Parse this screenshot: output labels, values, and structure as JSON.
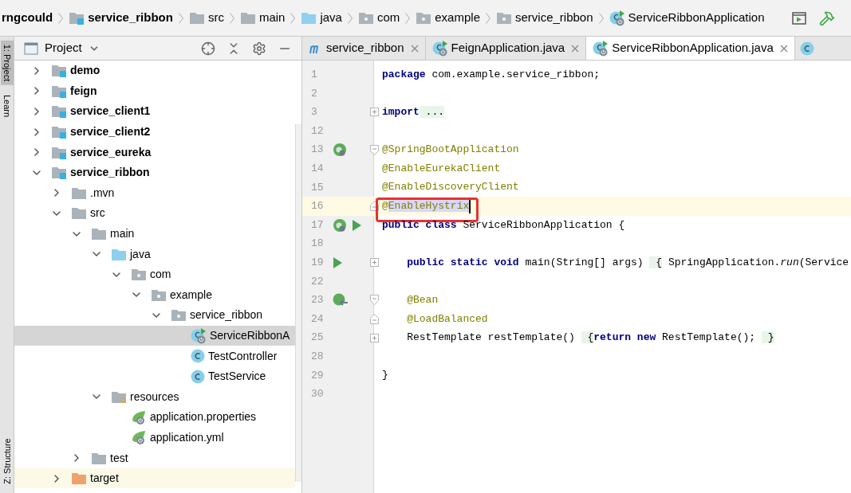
{
  "breadcrumbs": [
    {
      "label": "rngcould",
      "kind": "none",
      "bold": true
    },
    {
      "label": "service_ribbon",
      "kind": "module",
      "bold": true
    },
    {
      "label": "src",
      "kind": "folder",
      "bold": false
    },
    {
      "label": "main",
      "kind": "folder",
      "bold": false
    },
    {
      "label": "java",
      "kind": "source-folder",
      "bold": false
    },
    {
      "label": "com",
      "kind": "package",
      "bold": false
    },
    {
      "label": "example",
      "kind": "package",
      "bold": false
    },
    {
      "label": "service_ribbon",
      "kind": "package",
      "bold": false
    },
    {
      "label": "ServiceRibbonApplication",
      "kind": "spring-class",
      "bold": false
    }
  ],
  "side_tabs": [
    {
      "label": "1: Project",
      "selected": true
    },
    {
      "label": "Learn",
      "selected": false
    },
    {
      "label": "Z: Structure",
      "selected": false
    }
  ],
  "project_panel": {
    "title": "Project",
    "tree": [
      {
        "label": "demo",
        "kind": "module",
        "bold": true,
        "expanded": false
      },
      {
        "label": "feign",
        "kind": "module",
        "bold": true,
        "expanded": false
      },
      {
        "label": "service_client1",
        "kind": "module",
        "bold": true,
        "expanded": false
      },
      {
        "label": "service_client2",
        "kind": "module",
        "bold": true,
        "expanded": false
      },
      {
        "label": "service_eureka",
        "kind": "module",
        "bold": true,
        "expanded": false
      },
      {
        "label": "service_ribbon",
        "kind": "module",
        "bold": true,
        "expanded": true,
        "children": [
          {
            "label": ".mvn",
            "kind": "folder",
            "bold": false,
            "expanded": false
          },
          {
            "label": "src",
            "kind": "folder",
            "bold": false,
            "expanded": true,
            "children": [
              {
                "label": "main",
                "kind": "folder",
                "bold": false,
                "expanded": true,
                "children": [
                  {
                    "label": "java",
                    "kind": "source-folder",
                    "bold": false,
                    "expanded": true,
                    "children": [
                      {
                        "label": "com",
                        "kind": "package",
                        "bold": false,
                        "expanded": true,
                        "children": [
                          {
                            "label": "example",
                            "kind": "package",
                            "bold": false,
                            "expanded": true,
                            "children": [
                              {
                                "label": "service_ribbon",
                                "kind": "package",
                                "bold": false,
                                "expanded": true,
                                "children": [
                                  {
                                    "label": "ServiceRibbonA",
                                    "kind": "spring-class",
                                    "bold": false,
                                    "selected": true
                                  },
                                  {
                                    "label": "TestController",
                                    "kind": "class",
                                    "bold": false,
                                    "selected": false
                                  },
                                  {
                                    "label": "TestService",
                                    "kind": "class",
                                    "bold": false,
                                    "selected": false
                                  }
                                ]
                              }
                            ]
                          }
                        ]
                      }
                    ]
                  },
                  {
                    "label": "resources",
                    "kind": "resources-folder",
                    "bold": false,
                    "expanded": true,
                    "children": [
                      {
                        "label": "application.properties",
                        "kind": "spring-config",
                        "bold": false,
                        "selected": false
                      },
                      {
                        "label": "application.yml",
                        "kind": "spring-config",
                        "bold": false,
                        "selected": false
                      }
                    ]
                  }
                ]
              },
              {
                "label": "test",
                "kind": "folder",
                "bold": false,
                "expanded": false
              }
            ]
          },
          {
            "label": "target",
            "kind": "excluded-folder",
            "bold": false,
            "expanded": false
          }
        ]
      }
    ]
  },
  "editor": {
    "tabs": [
      {
        "label": "service_ribbon",
        "kind": "maven",
        "selected": false
      },
      {
        "label": "FeignApplication.java",
        "kind": "spring-class",
        "selected": false
      },
      {
        "label": "ServiceRibbonApplication.java",
        "kind": "spring-class",
        "selected": true
      }
    ],
    "lines": [
      {
        "number": "1",
        "tokens": [
          {
            "kind": "keyword",
            "text": "package"
          },
          {
            "kind": "plain",
            "text": " com.example.service_ribbon;"
          }
        ]
      },
      {
        "number": "2"
      },
      {
        "number": "3",
        "fold": {
          "kind": "plus"
        },
        "tokens": [
          {
            "kind": "keyword",
            "text": "import"
          },
          {
            "kind": "folded",
            "text": " ..."
          }
        ]
      },
      {
        "number": "12"
      },
      {
        "number": "13",
        "gutter": [
          {
            "kind": "spring-bean"
          }
        ],
        "fold": {
          "kind": "open"
        },
        "tokens": [
          {
            "kind": "annotation",
            "text": "@SpringBootApplication"
          }
        ]
      },
      {
        "number": "14",
        "tokens": [
          {
            "kind": "annotation",
            "text": "@EnableEurekaClient"
          }
        ]
      },
      {
        "number": "15",
        "tokens": [
          {
            "kind": "annotation",
            "text": "@EnableDiscoveryClient"
          }
        ]
      },
      {
        "number": "16",
        "fold": {
          "kind": "close"
        },
        "current": true,
        "marked": true,
        "tokens": [
          {
            "kind": "annotation",
            "text": "@"
          },
          {
            "kind": "selection",
            "text": "EnableHystrix"
          }
        ]
      },
      {
        "number": "17",
        "gutter": [
          {
            "kind": "spring-bean"
          },
          {
            "kind": "run"
          }
        ],
        "tokens": [
          {
            "kind": "keyword",
            "text": "public class"
          },
          {
            "kind": "plain",
            "text": " ServiceRibbonApplication {"
          }
        ]
      },
      {
        "number": "18"
      },
      {
        "number": "19",
        "gutter": [
          {
            "kind": "run"
          }
        ],
        "fold": {
          "kind": "plus"
        },
        "tokens": [
          {
            "kind": "keyword",
            "text": "    public static void"
          },
          {
            "kind": "plain",
            "text": " main(String[] args) "
          },
          {
            "kind": "folded",
            "text": " {"
          },
          {
            "kind": "plain",
            "text": " SpringApplication."
          },
          {
            "kind": "italic",
            "text": "run"
          },
          {
            "kind": "plain",
            "text": "(Service"
          }
        ]
      },
      {
        "number": "22"
      },
      {
        "number": "23",
        "gutter": [
          {
            "kind": "bean-arrow"
          }
        ],
        "fold": {
          "kind": "open"
        },
        "tokens": [
          {
            "kind": "annotation",
            "text": "    @Bean"
          }
        ]
      },
      {
        "number": "24",
        "fold": {
          "kind": "close"
        },
        "tokens": [
          {
            "kind": "annotation",
            "text": "    @LoadBalanced"
          }
        ]
      },
      {
        "number": "25",
        "fold": {
          "kind": "plus"
        },
        "tokens": [
          {
            "kind": "plain",
            "text": "    RestTemplate restTemplate() "
          },
          {
            "kind": "folded",
            "text": " {"
          },
          {
            "kind": "keyword",
            "text": "return new"
          },
          {
            "kind": "plain",
            "text": " RestTemplate(); "
          },
          {
            "kind": "folded",
            "text": " }"
          }
        ]
      },
      {
        "number": "28"
      },
      {
        "number": "29",
        "tokens": [
          {
            "kind": "plain",
            "text": "}"
          }
        ]
      },
      {
        "number": "30"
      }
    ]
  }
}
